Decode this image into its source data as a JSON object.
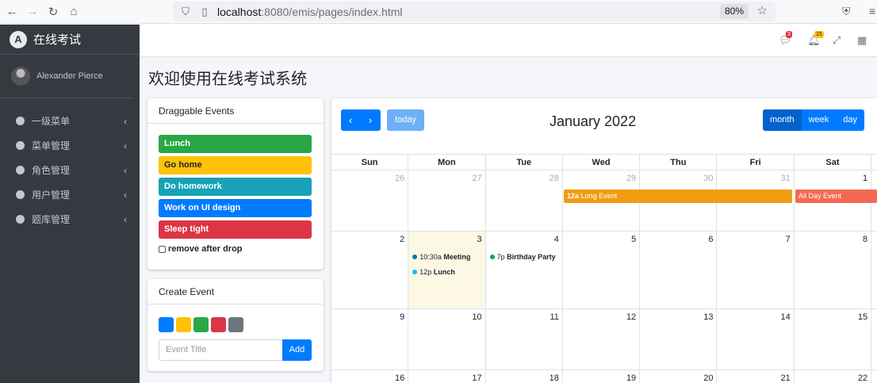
{
  "browser": {
    "url_host": "localhost",
    "url_path": ":8080/emis/pages/index.html",
    "zoom": "80%"
  },
  "sidebar": {
    "brand_logo": "A",
    "brand": "在线考试",
    "user": "Alexander Pierce",
    "items": [
      {
        "label": "一级菜单"
      },
      {
        "label": "菜单管理"
      },
      {
        "label": "角色管理"
      },
      {
        "label": "用户管理"
      },
      {
        "label": "题库管理"
      }
    ]
  },
  "topbar": {
    "messages_badge": "3",
    "notifications_badge": "15"
  },
  "page": {
    "title": "欢迎使用在线考试系统"
  },
  "draggable": {
    "header": "Draggable Events",
    "events": [
      {
        "label": "Lunch",
        "color": "#28a745"
      },
      {
        "label": "Go home",
        "color": "#ffc107"
      },
      {
        "label": "Do homework",
        "color": "#17a2b8"
      },
      {
        "label": "Work on UI design",
        "color": "#007bff"
      },
      {
        "label": "Sleep tight",
        "color": "#dc3545"
      }
    ],
    "remove_label": "remove after drop"
  },
  "create_event": {
    "header": "Create Event",
    "swatches": [
      "#007bff",
      "#ffc107",
      "#28a745",
      "#dc3545",
      "#6c757d"
    ],
    "placeholder": "Event Title",
    "add_label": "Add"
  },
  "calendar": {
    "title": "January 2022",
    "today_label": "today",
    "prev_icon": "chevron-left-icon",
    "next_icon": "chevron-right-icon",
    "views": [
      "month",
      "week",
      "day"
    ],
    "active_view": "month",
    "dow": [
      "Sun",
      "Mon",
      "Tue",
      "Wed",
      "Thu",
      "Fri",
      "Sat"
    ],
    "weeks": [
      [
        "26",
        "27",
        "28",
        "29",
        "30",
        "31",
        "1"
      ],
      [
        "2",
        "3",
        "4",
        "5",
        "6",
        "7",
        "8"
      ],
      [
        "9",
        "10",
        "11",
        "12",
        "13",
        "14",
        "15"
      ],
      [
        "16",
        "17",
        "18",
        "19",
        "20",
        "21",
        "22"
      ]
    ],
    "long_event": {
      "time": "12a",
      "title": "Long Event",
      "color": "#f39c12"
    },
    "all_day_event": {
      "title": "All Day Event",
      "color": "#f56954"
    },
    "meeting": {
      "time": "10:30a",
      "title": "Meeting",
      "color": "#0073b7"
    },
    "lunch": {
      "time": "12p",
      "title": "Lunch",
      "color": "#00c0ef"
    },
    "party": {
      "time": "7p",
      "title": "Birthday Party",
      "color": "#00a65a"
    }
  }
}
